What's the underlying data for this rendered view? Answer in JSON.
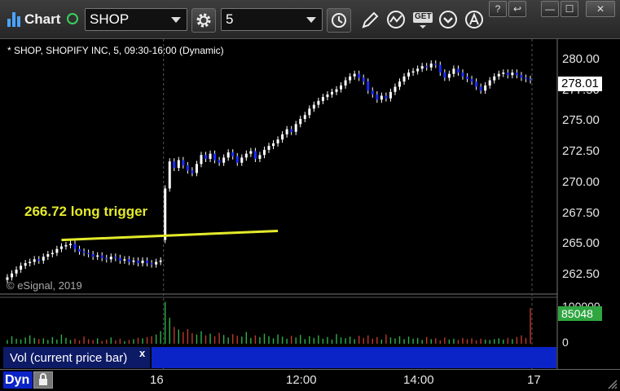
{
  "toolbar": {
    "title": "Chart",
    "symbol": "SHOP",
    "interval": "5",
    "get_label": "GET"
  },
  "window_buttons": [
    "?",
    "↩",
    "—",
    "☐",
    "✕"
  ],
  "chart_info": {
    "instrument_label": "* SHOP, SHOPIFY INC, 5, 09:30-16:00 (Dynamic)",
    "watermark": "© eSignal, 2019",
    "annotation": "266.72 long trigger",
    "last_price": "278.01",
    "volume_value": "85048",
    "volume_legend": "Vol (current price bar)",
    "legend_close": "x",
    "dyn_label": "Dyn"
  },
  "colors": {
    "up": "#ffffff",
    "down": "#1a2cff",
    "vol_up": "#2bb34a",
    "vol_down": "#c0392b",
    "annotation": "#e4ea2b",
    "grid": "#555555"
  },
  "chart_data": [
    {
      "type": "candlestick",
      "title": "",
      "y_ticks": [
        "280.00",
        "277.50",
        "275.00",
        "272.50",
        "270.00",
        "267.50",
        "265.00",
        "262.50"
      ],
      "ylim": [
        261.4,
        281.2
      ],
      "x_ticks": [
        "16",
        "12:00",
        "14:00",
        "17"
      ],
      "session_break_index": 35,
      "trendline": {
        "label": "266.72 long trigger",
        "from_index": 12,
        "to_index": 60,
        "from_price": 265.6,
        "to_price": 266.3
      },
      "closes": [
        262.7,
        263.0,
        263.3,
        263.6,
        263.8,
        263.9,
        264.1,
        264.0,
        264.3,
        264.5,
        264.6,
        264.9,
        265.1,
        265.2,
        265.3,
        264.9,
        264.7,
        264.6,
        264.5,
        264.3,
        264.4,
        264.2,
        264.1,
        264.3,
        264.2,
        264.0,
        264.1,
        263.9,
        264.0,
        263.8,
        264.0,
        263.8,
        263.7,
        263.9,
        264.0,
        269.6,
        271.7,
        271.2,
        271.8,
        271.4,
        271.0,
        270.8,
        271.5,
        272.2,
        271.9,
        272.3,
        271.8,
        271.6,
        272.0,
        272.4,
        272.1,
        271.6,
        272.0,
        272.3,
        272.5,
        271.9,
        272.2,
        272.6,
        272.9,
        273.1,
        273.4,
        273.8,
        274.2,
        274.0,
        274.6,
        275.0,
        275.3,
        275.8,
        276.1,
        276.4,
        276.7,
        276.9,
        277.1,
        277.3,
        277.6,
        278.0,
        278.3,
        278.5,
        278.2,
        277.9,
        277.2,
        276.9,
        276.5,
        276.8,
        276.6,
        277.1,
        277.5,
        277.9,
        278.3,
        278.6,
        278.7,
        278.9,
        279.1,
        279.0,
        279.3,
        279.2,
        278.6,
        278.2,
        278.5,
        278.9,
        278.6,
        278.3,
        278.1,
        277.9,
        277.5,
        277.2,
        277.6,
        278.0,
        278.3,
        278.5,
        278.6,
        278.4,
        278.6,
        278.4,
        278.2,
        278.1,
        278.0
      ]
    },
    {
      "type": "bar",
      "title": "Vol (current price bar)",
      "y_ticks": [
        "100000",
        "0"
      ],
      "ylim": [
        0,
        105000
      ],
      "volume": [
        9000,
        18000,
        12000,
        10000,
        15000,
        20000,
        14000,
        11000,
        13000,
        9000,
        16000,
        10000,
        22000,
        14000,
        9000,
        12000,
        8000,
        17000,
        11000,
        9000,
        13000,
        7000,
        10000,
        15000,
        8000,
        12000,
        6000,
        9000,
        11000,
        14000,
        13000,
        16000,
        18000,
        22000,
        30000,
        100000,
        62000,
        40000,
        34000,
        28000,
        35000,
        25000,
        22000,
        30000,
        20000,
        24000,
        18000,
        26000,
        21000,
        15000,
        23000,
        19000,
        17000,
        28000,
        14000,
        20000,
        16000,
        24000,
        18000,
        13000,
        22000,
        17000,
        12000,
        19000,
        15000,
        21000,
        11000,
        18000,
        14000,
        20000,
        12000,
        16000,
        10000,
        23000,
        15000,
        13000,
        17000,
        11000,
        19000,
        14000,
        20000,
        12000,
        16000,
        10000,
        22000,
        15000,
        13000,
        18000,
        11000,
        17000,
        12000,
        14000,
        9000,
        16000,
        11000,
        13000,
        8000,
        15000,
        10000,
        12000,
        9000,
        14000,
        11000,
        13000,
        8000,
        12000,
        10000,
        9000,
        11000,
        13000,
        10000,
        14000,
        11000,
        16000,
        20000,
        14000,
        85048
      ]
    }
  ]
}
